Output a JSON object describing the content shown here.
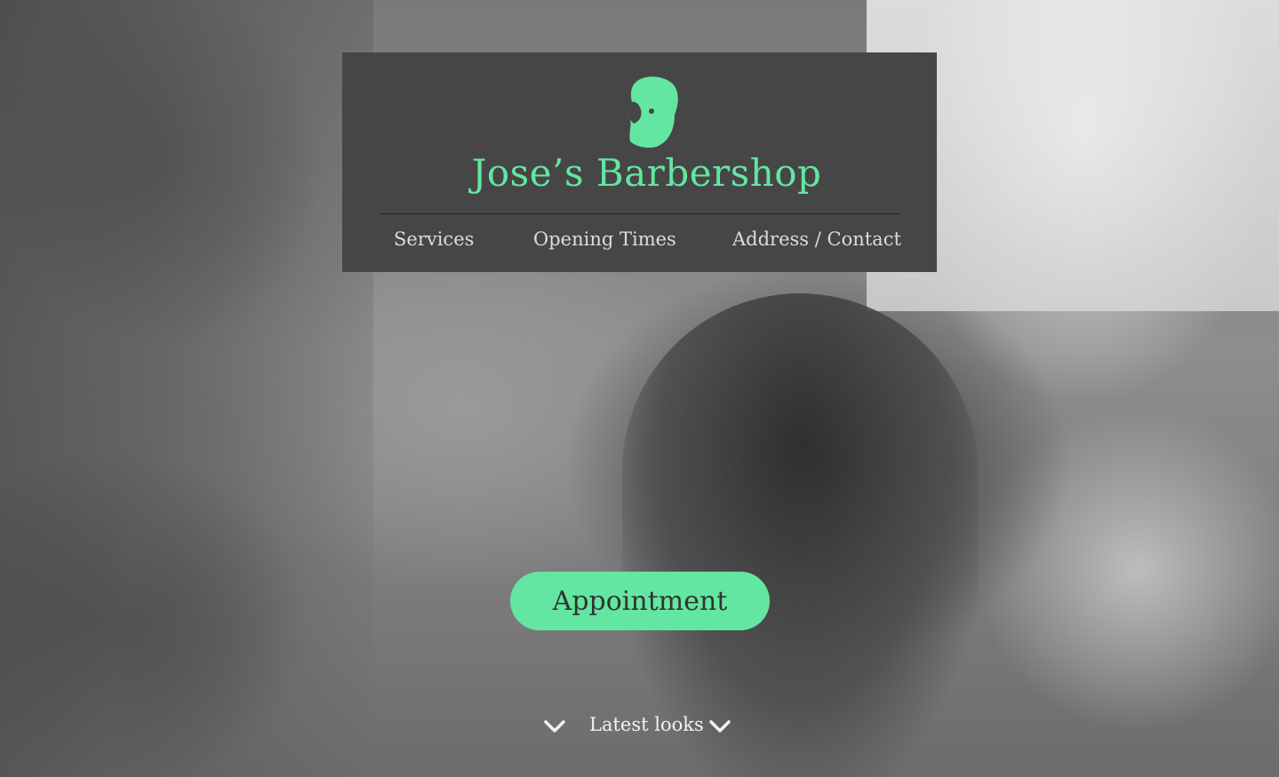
{
  "brand": {
    "name": "Jose’s Barbershop",
    "logo_icon": "bearded-man-head-icon"
  },
  "nav": {
    "items": [
      {
        "label": "Services"
      },
      {
        "label": "Opening Times"
      },
      {
        "label": "Address / Contact"
      }
    ]
  },
  "hero": {
    "background": "grayscale photo of a barber cutting a client's hair",
    "cta_label": "Appointment"
  },
  "footer_link": {
    "label": "Latest looks",
    "icon": "chevron-down-icon"
  },
  "colors": {
    "accent": "#63e6a1",
    "header_bg": "#464646",
    "nav_text": "#dcdcdc"
  }
}
